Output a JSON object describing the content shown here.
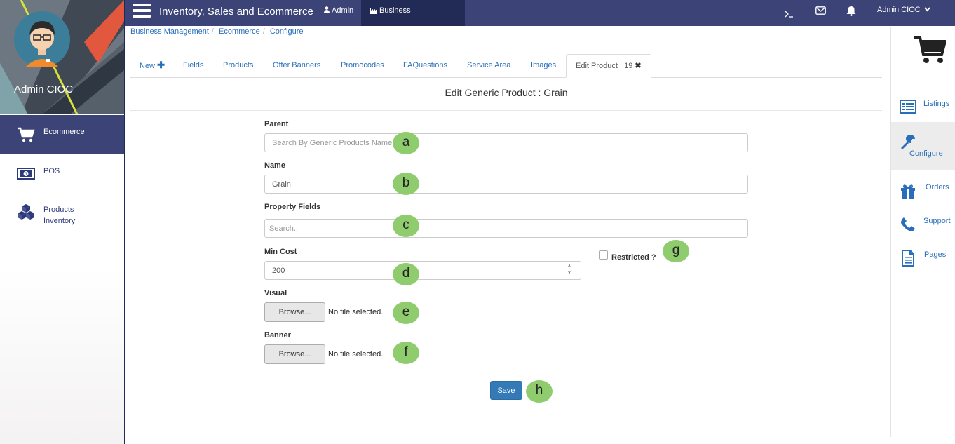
{
  "app": {
    "title": "Inventory, Sales and Ecommerce"
  },
  "topnav": {
    "admin_label": "Admin",
    "business_label": "Business Management",
    "user_menu_label": "Admin CIOC"
  },
  "profile": {
    "name": "Admin CIOC"
  },
  "sidebar": {
    "items": [
      {
        "label": "Ecommerce",
        "icon": "cart-icon"
      },
      {
        "label": "POS",
        "icon": "cash-icon"
      },
      {
        "label_line1": "Products",
        "label_line2": "Inventory",
        "icon": "cubes-icon"
      }
    ]
  },
  "breadcrumb": [
    "Business Management",
    "Ecommerce",
    "Configure"
  ],
  "tabs": [
    "New",
    "Fields",
    "Products",
    "Offer Banners",
    "Promocodes",
    "FAQuestions",
    "Service Area",
    "Images",
    "Edit Product : 19"
  ],
  "form": {
    "title": "Edit Generic Product : Grain",
    "parent_label": "Parent",
    "parent_placeholder": "Search By Generic Products Name",
    "name_label": "Name",
    "name_value": "Grain",
    "property_label": "Property Fields",
    "property_placeholder": "Search..",
    "mincost_label": "Min Cost",
    "mincost_value": "200",
    "restricted_label": "Restricted ?",
    "visual_label": "Visual",
    "banner_label": "Banner",
    "browse_label": "Browse...",
    "no_file": "No file selected.",
    "save_label": "Save"
  },
  "markers": [
    "a",
    "b",
    "c",
    "d",
    "e",
    "f",
    "g",
    "h"
  ],
  "right_panel": {
    "items": [
      {
        "label": "Listings",
        "icon": "list-icon"
      },
      {
        "label": "Configure",
        "icon": "wrench-icon"
      },
      {
        "label": "Orders",
        "icon": "gift-icon"
      },
      {
        "label": "Support",
        "icon": "phone-icon"
      },
      {
        "label": "Pages",
        "icon": "document-icon"
      }
    ]
  },
  "colors": {
    "navbar": "#3b4377",
    "navbar_active": "#222a56",
    "link": "#2a6ebb",
    "primary_button": "#337ab7",
    "marker": "#8fcc6e"
  }
}
